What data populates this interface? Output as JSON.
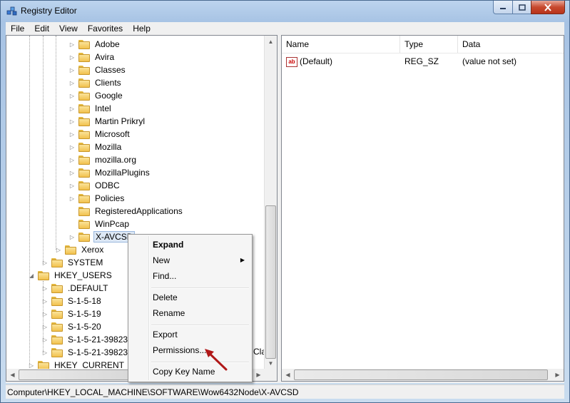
{
  "window": {
    "title": "Registry Editor"
  },
  "menu": [
    "File",
    "Edit",
    "View",
    "Favorites",
    "Help"
  ],
  "tree": {
    "items": [
      {
        "label": "Adobe",
        "level": 3
      },
      {
        "label": "Avira",
        "level": 3
      },
      {
        "label": "Classes",
        "level": 3
      },
      {
        "label": "Clients",
        "level": 3
      },
      {
        "label": "Google",
        "level": 3
      },
      {
        "label": "Intel",
        "level": 3
      },
      {
        "label": "Martin Prikryl",
        "level": 3
      },
      {
        "label": "Microsoft",
        "level": 3
      },
      {
        "label": "Mozilla",
        "level": 3
      },
      {
        "label": "mozilla.org",
        "level": 3
      },
      {
        "label": "MozillaPlugins",
        "level": 3
      },
      {
        "label": "ODBC",
        "level": 3
      },
      {
        "label": "Policies",
        "level": 3
      },
      {
        "label": "RegisteredApplications",
        "level": 3
      },
      {
        "label": "WinPcap",
        "level": 3
      },
      {
        "label": "X-AVCSD",
        "level": 3
      },
      {
        "label": "Xerox",
        "level": 2
      },
      {
        "label": "SYSTEM",
        "level": 1
      },
      {
        "label": "HKEY_USERS",
        "level": 0
      },
      {
        "label": ".DEFAULT",
        "level": 1
      },
      {
        "label": "S-1-5-18",
        "level": 1
      },
      {
        "label": "S-1-5-19",
        "level": 1
      },
      {
        "label": "S-1-5-20",
        "level": 1
      },
      {
        "label": "S-1-5-21-3982381",
        "level": 1
      },
      {
        "label": "S-1-5-21-3982381",
        "level": 1
      },
      {
        "label": "HKEY_CURRENT_CO",
        "level": 0
      }
    ],
    "clipped_suffix": "Cla"
  },
  "list": {
    "columns": [
      "Name",
      "Type",
      "Data"
    ],
    "rows": [
      {
        "name": "(Default)",
        "type": "REG_SZ",
        "data": "(value not set)",
        "icon": "ab-string-icon"
      }
    ]
  },
  "context_menu": {
    "items": [
      "Expand",
      "New",
      "Find...",
      "Delete",
      "Rename",
      "Export",
      "Permissions...",
      "Copy Key Name"
    ]
  },
  "statusbar": {
    "path": "Computer\\HKEY_LOCAL_MACHINE\\SOFTWARE\\Wow6432Node\\X-AVCSD"
  },
  "colors": {
    "annotation_arrow": "#b01818",
    "selection": "#dde8f5"
  }
}
